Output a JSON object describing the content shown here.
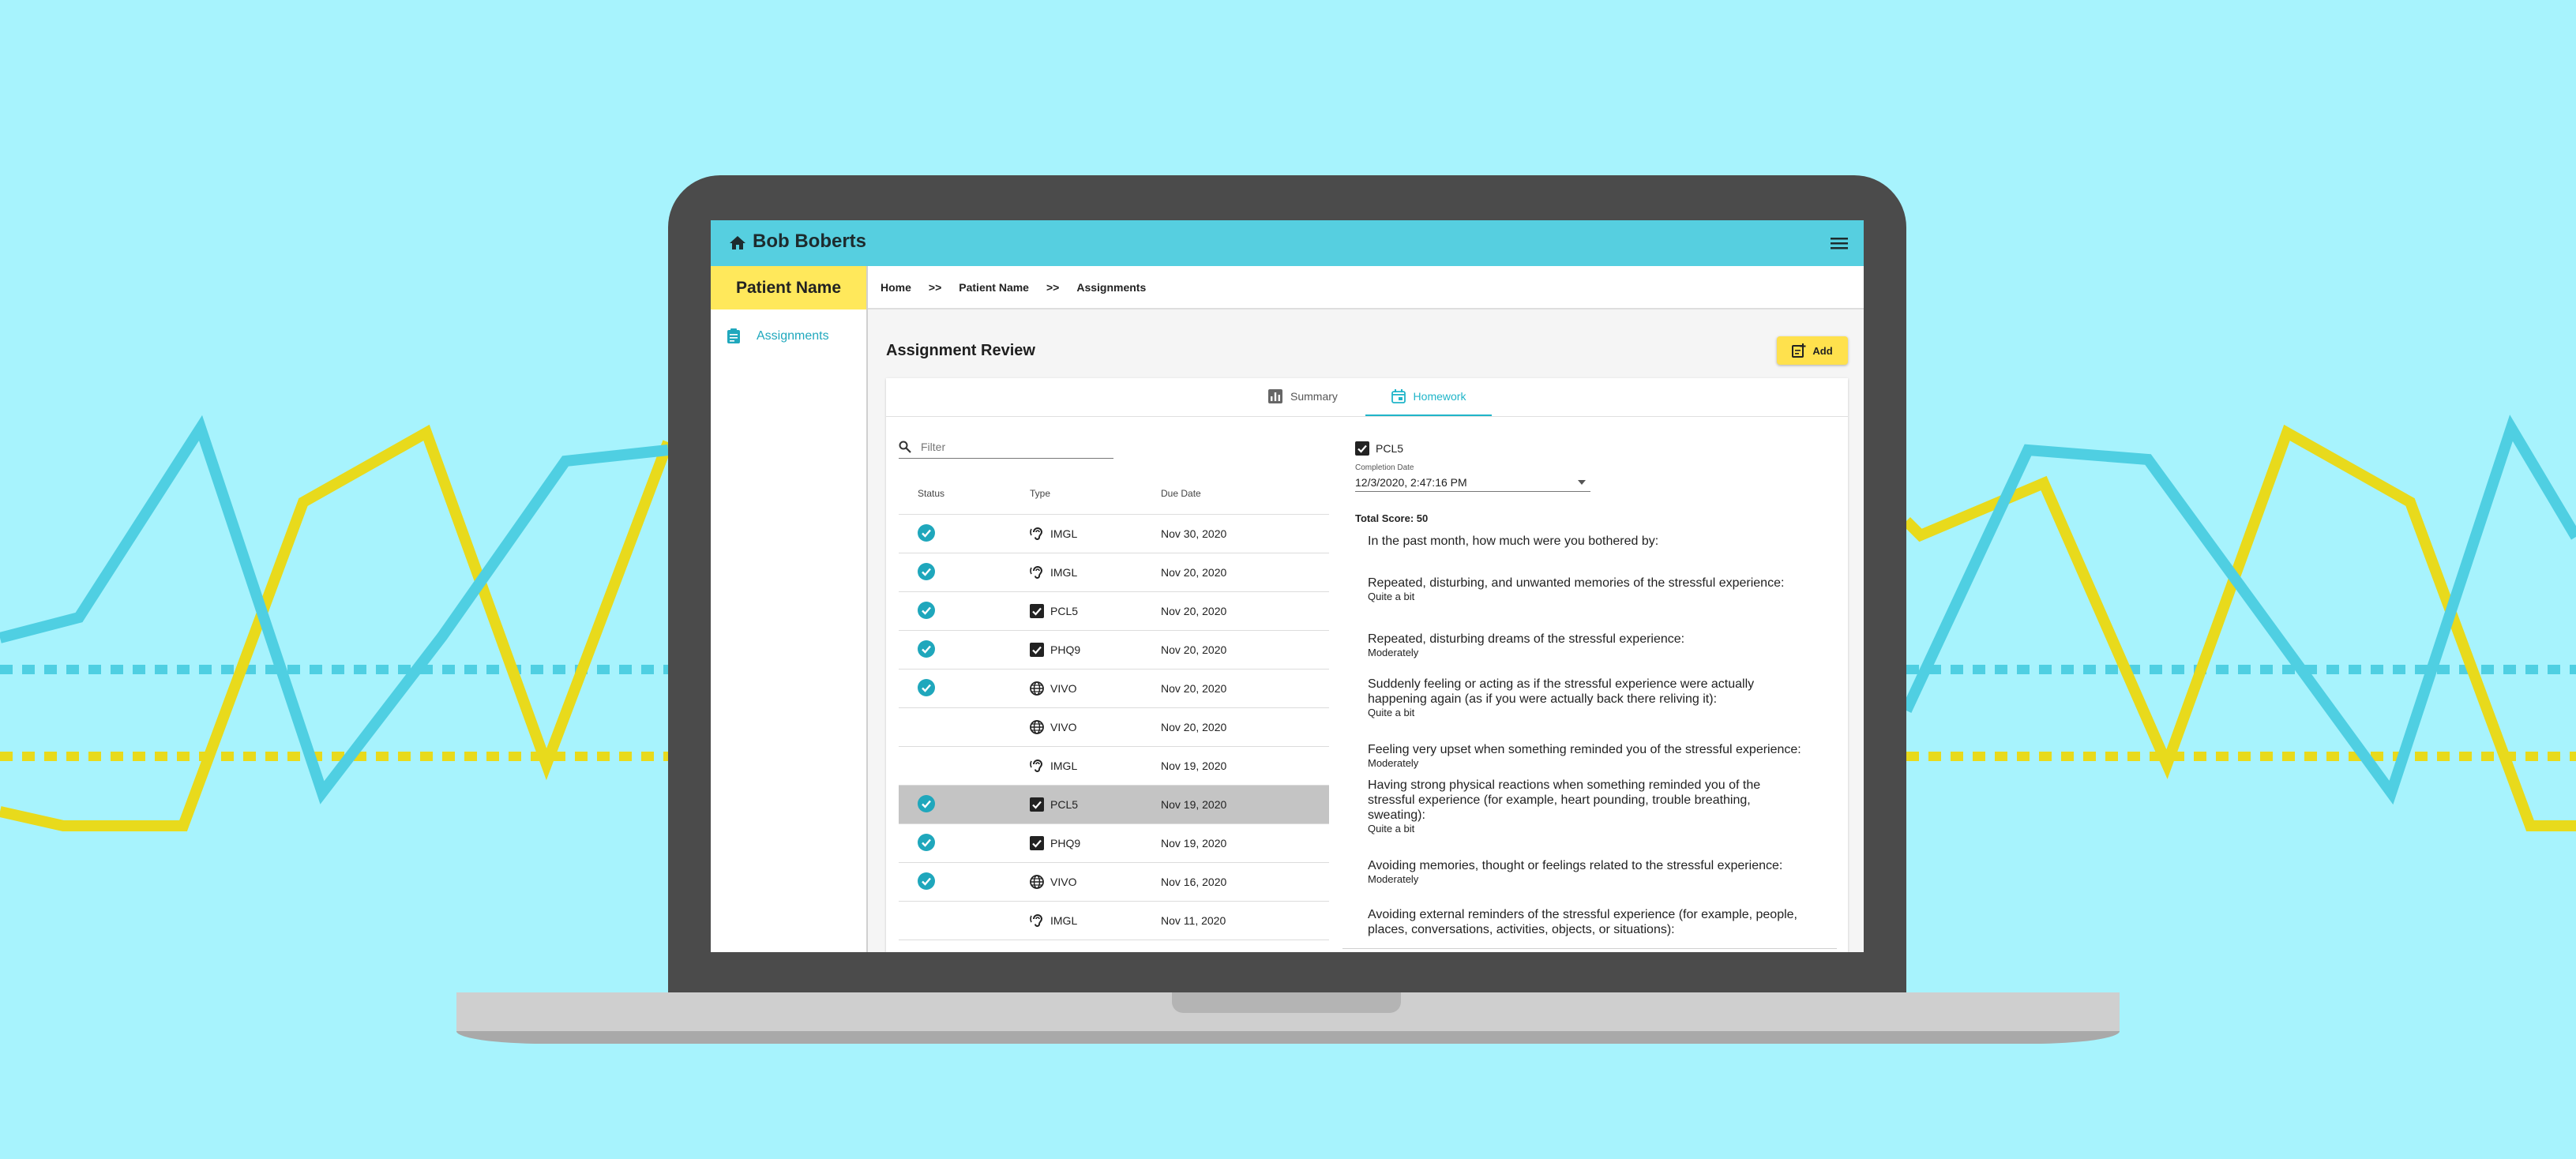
{
  "colors": {
    "background": "#a7f3fd",
    "topbar": "#56cfe0",
    "accent": "#20a8bd",
    "highlight": "#ffe85b",
    "line_blue": "#4fcfe2",
    "line_yellow": "#e8da1c"
  },
  "app": {
    "user_name": "Bob Boberts",
    "patient_label": "Patient Name"
  },
  "sidebar": {
    "items": [
      {
        "label": "Assignments",
        "icon": "clipboard-icon"
      }
    ]
  },
  "breadcrumb": {
    "items": [
      "Home",
      "Patient Name",
      "Assignments"
    ],
    "separator": ">>"
  },
  "main": {
    "title": "Assignment Review",
    "add_label": "Add"
  },
  "tabs": [
    {
      "label": "Summary",
      "icon": "bar-chart-icon"
    },
    {
      "label": "Homework",
      "icon": "calendar-icon",
      "active": true
    }
  ],
  "filter": {
    "placeholder": "Filter"
  },
  "table": {
    "headers": [
      "Status",
      "Type",
      "Due Date"
    ],
    "rows": [
      {
        "done": true,
        "type": "IMGL",
        "icon": "ear-icon",
        "date": "Nov 30, 2020"
      },
      {
        "done": true,
        "type": "IMGL",
        "icon": "ear-icon",
        "date": "Nov 20, 2020"
      },
      {
        "done": true,
        "type": "PCL5",
        "icon": "checkbox-icon",
        "date": "Nov 20, 2020"
      },
      {
        "done": true,
        "type": "PHQ9",
        "icon": "checkbox-icon",
        "date": "Nov 20, 2020"
      },
      {
        "done": true,
        "type": "VIVO",
        "icon": "globe-icon",
        "date": "Nov 20, 2020"
      },
      {
        "done": false,
        "type": "VIVO",
        "icon": "globe-icon",
        "date": "Nov 20, 2020"
      },
      {
        "done": false,
        "type": "IMGL",
        "icon": "ear-icon",
        "date": "Nov 19, 2020"
      },
      {
        "done": true,
        "type": "PCL5",
        "icon": "checkbox-icon",
        "date": "Nov 19, 2020",
        "selected": true
      },
      {
        "done": true,
        "type": "PHQ9",
        "icon": "checkbox-icon",
        "date": "Nov 19, 2020"
      },
      {
        "done": true,
        "type": "VIVO",
        "icon": "globe-icon",
        "date": "Nov 16, 2020"
      },
      {
        "done": false,
        "type": "IMGL",
        "icon": "ear-icon",
        "date": "Nov 11, 2020"
      }
    ]
  },
  "detail": {
    "title": "PCL5",
    "completion_label": "Completion Date",
    "completion_value": "12/3/2020, 2:47:16 PM",
    "total_score": "Total Score: 50",
    "intro": "In the past month, how much were you bothered by:",
    "questions": [
      {
        "q": "Repeated, disturbing, and unwanted memories of the stressful experience:",
        "a": "Quite a bit"
      },
      {
        "q": "Repeated, disturbing dreams of the stressful experience:",
        "a": "Moderately"
      },
      {
        "q": "Suddenly feeling or acting as if the stressful experience were actually happening again (as if you were actually back there reliving it):",
        "a": "Quite a bit"
      },
      {
        "q": "Feeling very upset when something reminded you of the stressful experience:",
        "a": "Moderately"
      },
      {
        "q": "Having strong physical reactions when something reminded you of the stressful experience (for example, heart pounding, trouble breathing, sweating):",
        "a": "Quite a bit"
      },
      {
        "q": "Avoiding memories, thought or feelings related to the stressful experience:",
        "a": "Moderately"
      },
      {
        "q": "Avoiding external reminders of the stressful experience (for example, people, places, conversations, activities, objects, or situations):",
        "a": ""
      }
    ]
  }
}
